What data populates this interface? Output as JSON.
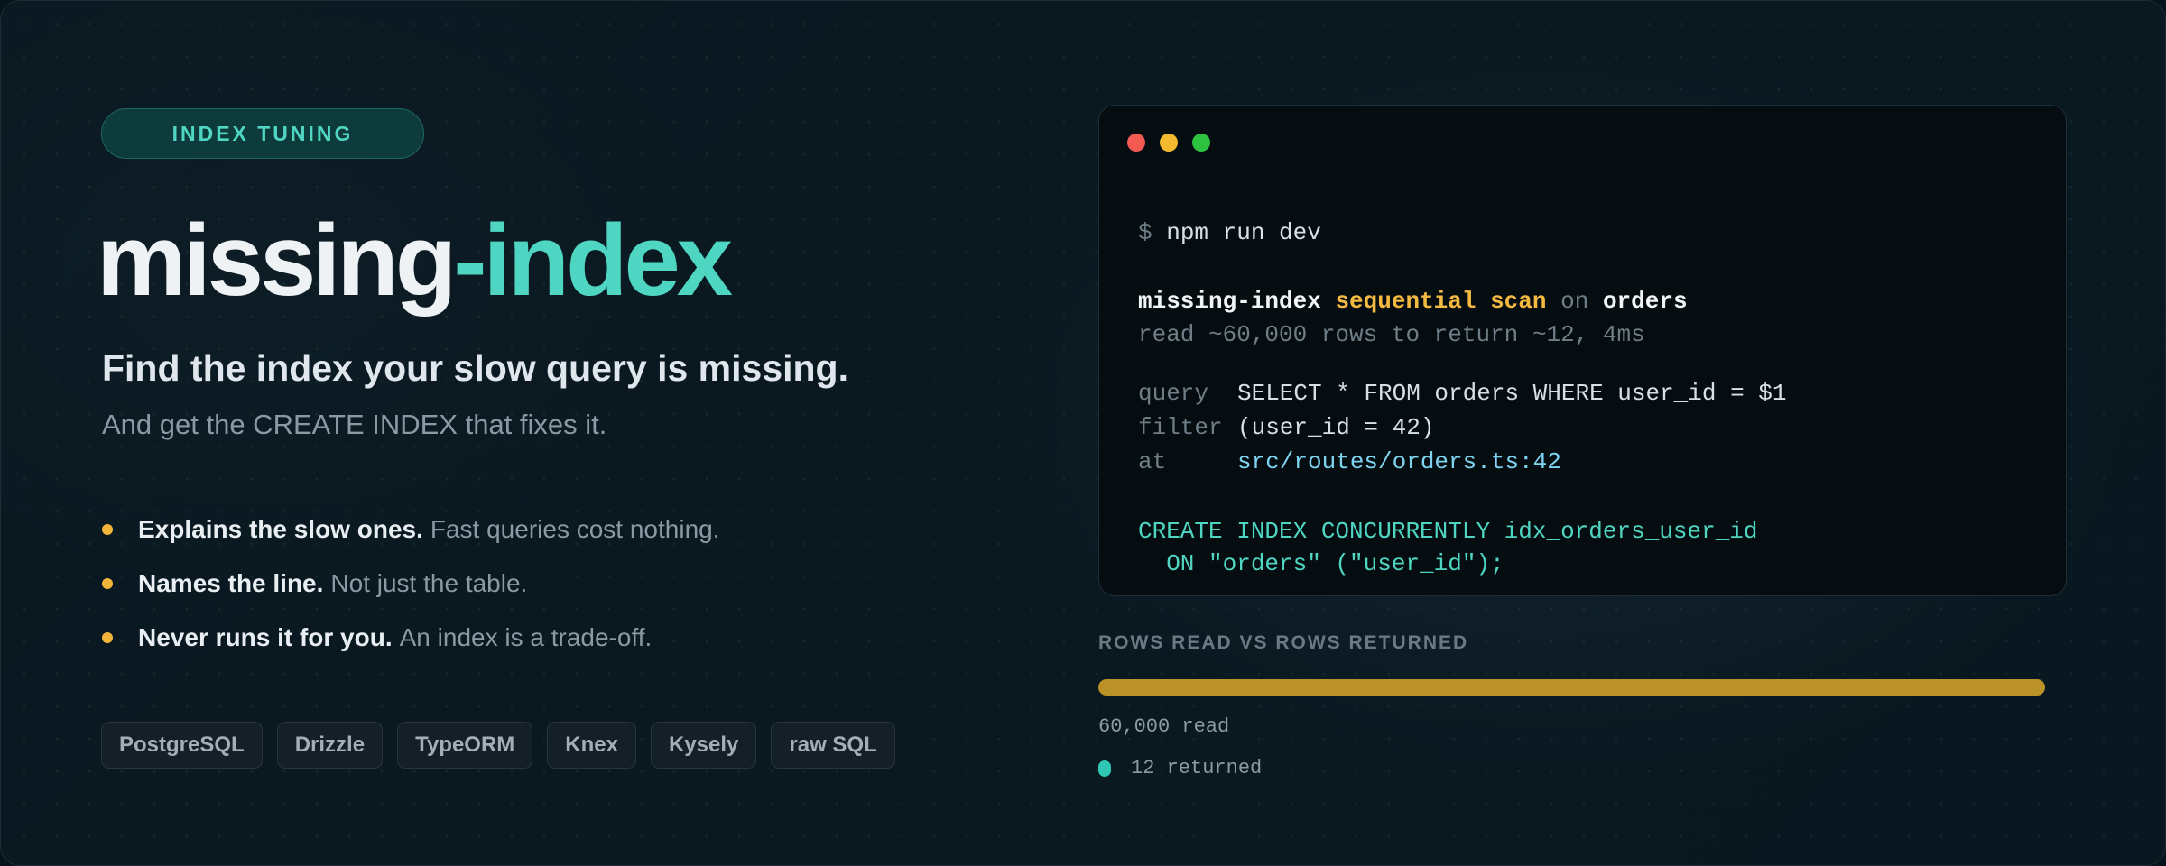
{
  "badge": {
    "label": "INDEX TUNING"
  },
  "hero": {
    "title_part1": "missing",
    "title_part2": "-index",
    "subtitle": "Find the index your slow query is missing.",
    "tagline": "And get the CREATE INDEX that fixes it."
  },
  "features": [
    {
      "strong": "Explains the slow ones.",
      "weak": "Fast queries cost nothing."
    },
    {
      "strong": "Names the line.",
      "weak": "Not just the table."
    },
    {
      "strong": "Never runs it for you.",
      "weak": "An index is a trade-off."
    }
  ],
  "chips": [
    "PostgreSQL",
    "Drizzle",
    "TypeORM",
    "Knex",
    "Kysely",
    "raw SQL"
  ],
  "terminal": {
    "prompt": "$",
    "command": "npm run dev",
    "report": {
      "tool": "missing-index",
      "finding": "sequential scan",
      "on": "on",
      "table": "orders",
      "detail": "read ~60,000 rows to return ~12, 4ms"
    },
    "query_key": "query",
    "query_val": "SELECT * FROM orders WHERE user_id = $1",
    "filter_key": "filter",
    "filter_val": "(user_id = 42)",
    "at_key": "at",
    "at_val": "src/routes/orders.ts:42",
    "sql_line1": "CREATE INDEX CONCURRENTLY idx_orders_user_id",
    "sql_line2": "  ON \"orders\" (\"user_id\");"
  },
  "rows": {
    "label": "ROWS READ VS ROWS RETURNED",
    "read_count": 60000,
    "returned_count": 12,
    "read_label": "60,000 read",
    "returned_label": "12 returned"
  },
  "colors": {
    "accent_teal": "#4fd6c2",
    "accent_yellow": "#f4b940",
    "bar_fill": "#bb9228",
    "background": "#0a1820"
  }
}
